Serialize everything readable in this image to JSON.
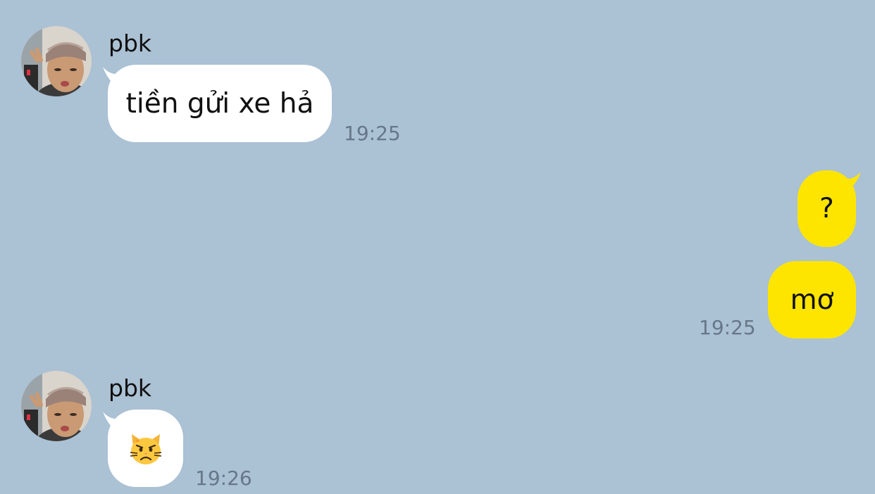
{
  "messages": [
    {
      "direction": "in",
      "sender": "pbk",
      "text": "tiền gửi xe hả",
      "time": "19:25"
    },
    {
      "direction": "out",
      "text": "?"
    },
    {
      "direction": "out",
      "text": "mơ",
      "time": "19:25"
    },
    {
      "direction": "in",
      "sender": "pbk",
      "emoji": "pouting-cat-face",
      "time": "19:26"
    }
  ],
  "colors": {
    "background": "#abc1d4",
    "incoming_bubble": "#ffffff",
    "outgoing_bubble": "#fee500",
    "timestamp": "#667788"
  }
}
